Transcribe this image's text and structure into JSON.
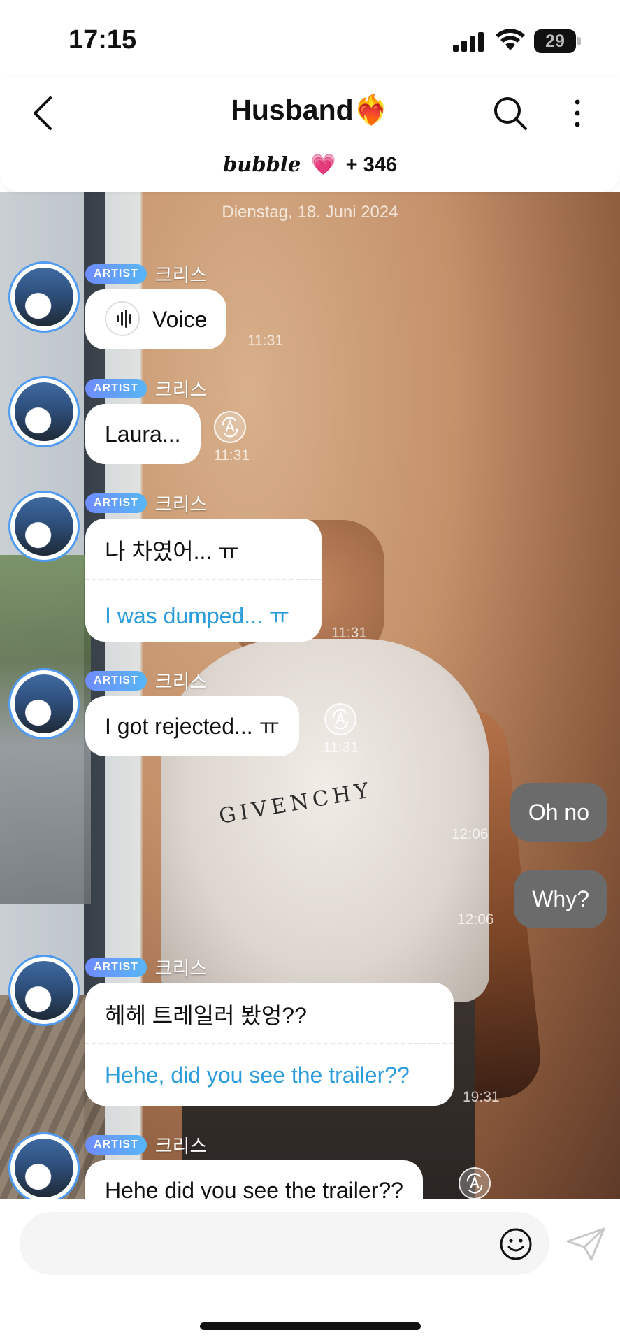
{
  "status_bar": {
    "time": "17:15",
    "battery": "29"
  },
  "header": {
    "title": "Husband❤️‍🔥",
    "subtitle_brand": "bubble",
    "subtitle_heart": "💗",
    "subtitle_count": "+ 346"
  },
  "chat": {
    "date": "Dienstag, 18. Juni 2024",
    "badge": "ARTIST",
    "sender": "크리스",
    "messages": [
      {
        "type": "voice",
        "text": "Voice",
        "time": "11:31"
      },
      {
        "type": "text",
        "text": "Laura...",
        "time": "11:31"
      },
      {
        "type": "dual",
        "ko": "나 차였어... ㅠ",
        "en": "I was dumped... ㅠ",
        "time": "11:31"
      },
      {
        "type": "text",
        "text": "I got rejected... ㅠ",
        "time": "11:31"
      },
      {
        "type": "mine",
        "text": "Oh no",
        "time": "12:06"
      },
      {
        "type": "mine",
        "text": "Why?",
        "time": "12:06"
      },
      {
        "type": "dual",
        "ko": "헤헤 트레일러 봤엉??",
        "en": "Hehe, did you see the trailer??",
        "time": "19:31"
      },
      {
        "type": "text",
        "text": "Hehe did you see the trailer??"
      }
    ]
  },
  "photo_text": "GIVENCHY",
  "colors": {
    "badge": "#6f8cff",
    "translation": "#2d9cdb",
    "my_bubble": "#6b6b6b",
    "avatar_ring": "#4f9bf3"
  }
}
